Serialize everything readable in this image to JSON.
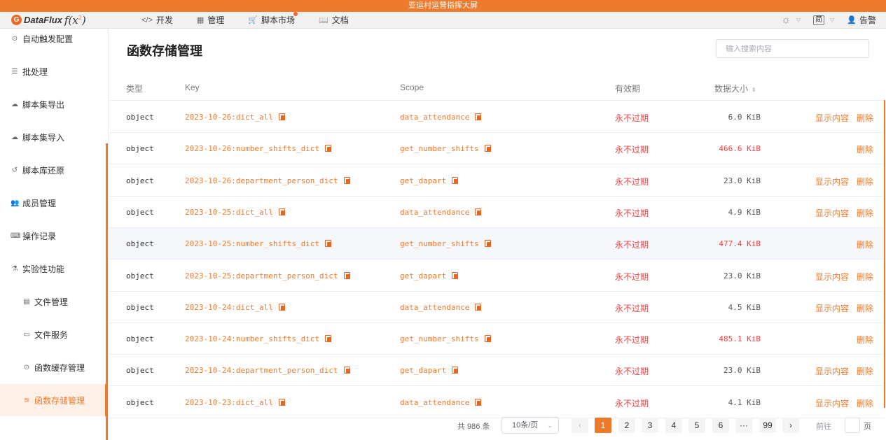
{
  "banner": "亚运村运营指挥大屏",
  "brand": {
    "logo_letter": "G",
    "name": "DataFlux",
    "fx": "f(x",
    "fx_sup": "2",
    "fx_end": ")"
  },
  "topnav": {
    "items": [
      {
        "icon": "</>",
        "label": "开发"
      },
      {
        "icon": "▦",
        "label": "管理"
      },
      {
        "icon": "🛒",
        "label": "脚本市场"
      },
      {
        "icon": "📖",
        "label": "文档"
      }
    ],
    "lang": "简",
    "user": "告警"
  },
  "sidebar": {
    "items": [
      {
        "icon": "⊙",
        "label": "自动触发配置"
      },
      {
        "icon": "☰",
        "label": "批处理"
      },
      {
        "icon": "☁",
        "label": "脚本集导出"
      },
      {
        "icon": "☁",
        "label": "脚本集导入"
      },
      {
        "icon": "↺",
        "label": "脚本库还原"
      },
      {
        "icon": "👥",
        "label": "成员管理"
      },
      {
        "icon": "⌨",
        "label": "操作记录"
      },
      {
        "icon": "⚗",
        "label": "实验性功能"
      },
      {
        "icon": "▤",
        "label": "文件管理"
      },
      {
        "icon": "▭",
        "label": "文件服务"
      },
      {
        "icon": "⊙",
        "label": "函数缓存管理"
      },
      {
        "icon": "≋",
        "label": "函数存储管理"
      }
    ]
  },
  "main": {
    "title": "函数存储管理",
    "search_placeholder": "输入搜索内容",
    "columns": {
      "type": "类型",
      "key": "Key",
      "scope": "Scope",
      "expire": "有效期",
      "size": "数据大小"
    },
    "rows": [
      {
        "type": "object",
        "key": "2023-10-26:dict_all",
        "scope": "data_attendance",
        "expire": "永不过期",
        "size": "6.0 KiB",
        "show": "显示内容",
        "del": "删除"
      },
      {
        "type": "object",
        "key": "2023-10-26:number_shifts_dict",
        "scope": "get_number_shifts",
        "expire": "永不过期",
        "size": "466.6 KiB",
        "show": "",
        "del": "删除"
      },
      {
        "type": "object",
        "key": "2023-10-26:department_person_dict",
        "scope": "get_dapart",
        "expire": "永不过期",
        "size": "23.0 KiB",
        "show": "显示内容",
        "del": "删除"
      },
      {
        "type": "object",
        "key": "2023-10-25:dict_all",
        "scope": "data_attendance",
        "expire": "永不过期",
        "size": "4.9 KiB",
        "show": "显示内容",
        "del": "删除"
      },
      {
        "type": "object",
        "key": "2023-10-25:number_shifts_dict",
        "scope": "get_number_shifts",
        "expire": "永不过期",
        "size": "477.4 KiB",
        "show": "",
        "del": "删除"
      },
      {
        "type": "object",
        "key": "2023-10-25:department_person_dict",
        "scope": "get_dapart",
        "expire": "永不过期",
        "size": "23.0 KiB",
        "show": "显示内容",
        "del": "删除"
      },
      {
        "type": "object",
        "key": "2023-10-24:dict_all",
        "scope": "data_attendance",
        "expire": "永不过期",
        "size": "4.5 KiB",
        "show": "显示内容",
        "del": "删除"
      },
      {
        "type": "object",
        "key": "2023-10-24:number_shifts_dict",
        "scope": "get_number_shifts",
        "expire": "永不过期",
        "size": "485.1 KiB",
        "show": "",
        "del": "删除"
      },
      {
        "type": "object",
        "key": "2023-10-24:department_person_dict",
        "scope": "get_dapart",
        "expire": "永不过期",
        "size": "23.0 KiB",
        "show": "显示内容",
        "del": "删除"
      },
      {
        "type": "object",
        "key": "2023-10-23:dict_all",
        "scope": "data_attendance",
        "expire": "永不过期",
        "size": "4.1 KiB",
        "show": "显示内容",
        "del": "删除"
      }
    ]
  },
  "pagination": {
    "total": "共 986 条",
    "page_size": "10条/页",
    "prev": "‹",
    "pages": [
      "1",
      "2",
      "3",
      "4",
      "5",
      "6",
      "···",
      "99"
    ],
    "next": "›",
    "goto": "前往",
    "goto_end": "页"
  },
  "colors": {
    "accent": "#ee7a2c",
    "danger": "#ee4444"
  }
}
